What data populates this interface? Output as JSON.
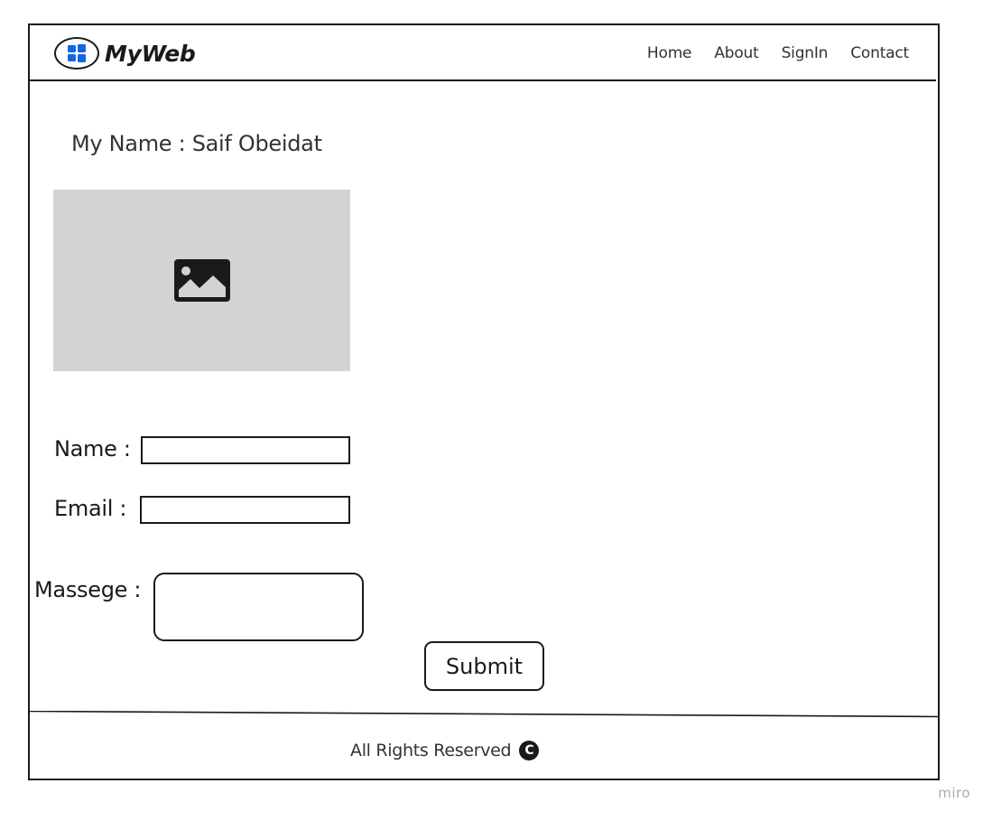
{
  "header": {
    "brand": "MyWeb",
    "logo_icon": "windows-logo-icon",
    "logo_color": "#1565e6",
    "nav": [
      {
        "label": "Home"
      },
      {
        "label": "About"
      },
      {
        "label": "SignIn"
      },
      {
        "label": "Contact"
      }
    ]
  },
  "main": {
    "my_name": "My Name : Saif Obeidat",
    "image_icon": "image-placeholder-icon",
    "image_bg": "#d3d3d3"
  },
  "form": {
    "name_label": "Name :",
    "name_value": "",
    "email_label": "Email :",
    "email_value": "",
    "message_label": "Massege :",
    "message_value": "",
    "submit_label": "Submit"
  },
  "footer": {
    "text": "All Rights Reserved",
    "icon": "copyright-icon",
    "icon_glyph": "C"
  },
  "watermark": "miro"
}
